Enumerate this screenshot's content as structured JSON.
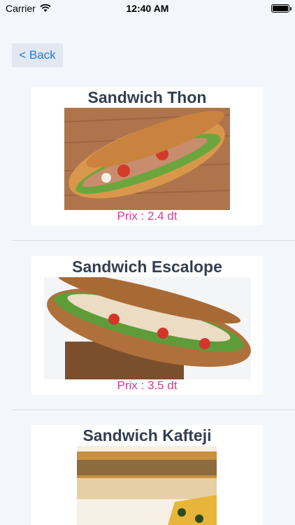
{
  "status": {
    "carrier": "Carrier",
    "time": "12:40 AM"
  },
  "nav": {
    "back_label": "< Back"
  },
  "items": [
    {
      "title": "Sandwich Thon",
      "price": "Prix : 2.4 dt"
    },
    {
      "title": "Sandwich Escalope",
      "price": "Prix : 3.5 dt"
    },
    {
      "title": "Sandwich Kafteji",
      "price": ""
    }
  ],
  "colors": {
    "background": "#f3f6fa",
    "title": "#333f4f",
    "price": "#d43f8d",
    "back_text": "#1e7bd8",
    "back_bg": "#e3e7f2"
  }
}
